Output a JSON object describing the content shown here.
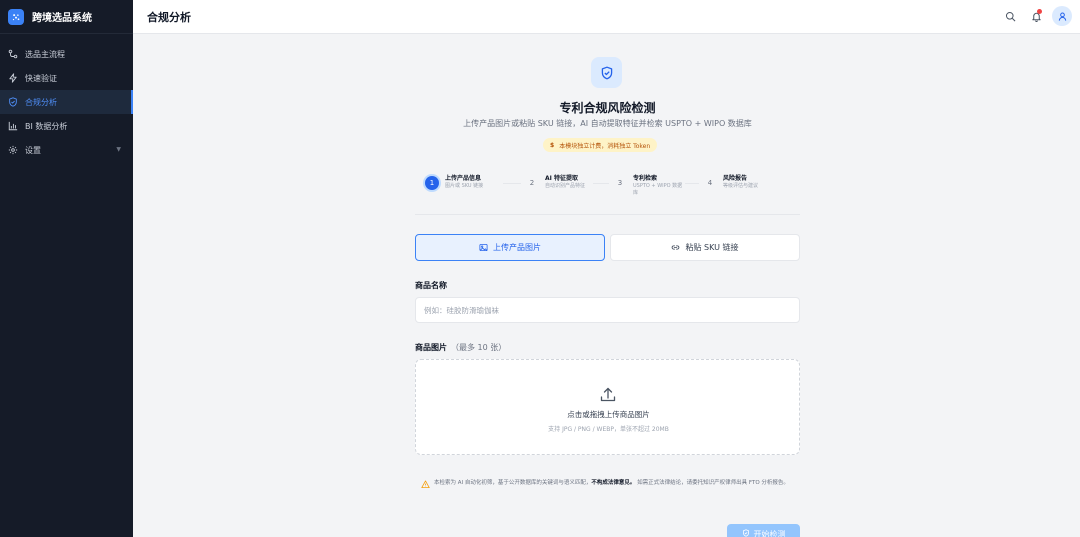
{
  "app": {
    "title": "跨境选品系统"
  },
  "sidebar": {
    "items": [
      {
        "label": "选品主流程",
        "icon": "workflow-icon",
        "active": false
      },
      {
        "label": "快速验证",
        "icon": "zap-icon",
        "active": false
      },
      {
        "label": "合规分析",
        "icon": "shield-check-icon",
        "active": true
      },
      {
        "label": "BI 数据分析",
        "icon": "bar-chart-icon",
        "active": false
      },
      {
        "label": "设置",
        "icon": "gear-icon",
        "active": false,
        "has_submenu": true
      }
    ]
  },
  "header": {
    "title": "合规分析",
    "icons": [
      "search-icon",
      "bell-icon",
      "user-icon"
    ]
  },
  "main": {
    "title": "专利合规风险检测",
    "subtitle": "上传产品图片或粘贴 SKU 链接，AI 自动提取特征并检索 USPTO + WIPO 数据库",
    "cost_badge": "本模块独立计费，消耗独立 Token",
    "cost_symbol": "$",
    "steps": [
      {
        "num": "1",
        "title": "上传产品信息",
        "desc": "图片或 SKU 链接"
      },
      {
        "num": "2",
        "title": "AI 特征提取",
        "desc": "自动识别产品特征"
      },
      {
        "num": "3",
        "title": "专利检索",
        "desc": "USPTO + WIPO 数据库"
      },
      {
        "num": "4",
        "title": "风险报告",
        "desc": "等级评估与建议"
      }
    ],
    "active_step": 1,
    "tabs": {
      "upload": "上传产品图片",
      "sku": "粘贴 SKU 链接"
    },
    "name_field": {
      "label": "商品名称",
      "placeholder": "例如：硅胶防滑瑜伽袜",
      "value": ""
    },
    "image_field": {
      "label": "商品图片",
      "hint": "（最多 10 张）"
    },
    "dropzone": {
      "text": "点击或拖拽上传商品图片",
      "subtext": "支持 JPG / PNG / WEBP，单张不超过 20MB"
    },
    "disclaimer": {
      "pre": "本检索为 AI 自动化初筛，基于公开数据库的关键词与语义匹配，",
      "bold": "不构成法律意见。",
      "post": "如需正式法律结论，请委托知识产权律师出具 FTO 分析报告。"
    },
    "start_button": "开始检测"
  },
  "colors": {
    "accent": "#3b82f6",
    "sidebar_bg": "#151b28",
    "badge_bg": "#fef3c7",
    "badge_text": "#b45309",
    "warning": "#f59e0b"
  }
}
